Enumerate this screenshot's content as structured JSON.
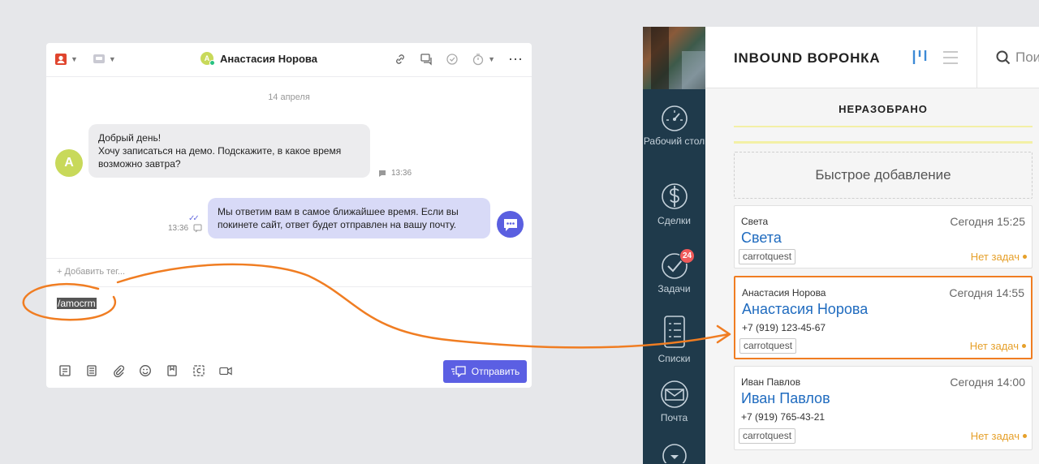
{
  "chat": {
    "contact_name": "Анастасия Норова",
    "avatar_letter": "А",
    "date_separator": "14 апреля",
    "incoming": {
      "lines": [
        "Добрый день!",
        "Хочу записаться на демо. Подскажите, в какое время",
        "возможно завтра?"
      ],
      "time": "13:36"
    },
    "outgoing": {
      "lines": [
        "Мы ответим вам в самое ближайшее время. Если вы",
        "покинете сайт, ответ будет отправлен на вашу почту."
      ],
      "time": "13:36"
    },
    "add_tag": "+ Добавить тег...",
    "compose_text": "/amocrm",
    "send_label": "Отправить"
  },
  "crm": {
    "pipeline_title": "INBOUND ВОРОНКА",
    "search_placeholder": "Пои",
    "column_title": "НЕРАЗОБРАНО",
    "quick_add": "Быстрое добавление",
    "sidebar": [
      {
        "label": "Рабочий стол"
      },
      {
        "label": "Сделки"
      },
      {
        "label": "Задачи",
        "badge": "24"
      },
      {
        "label": "Списки"
      },
      {
        "label": "Почта"
      }
    ],
    "cards": [
      {
        "contact": "Света",
        "time": "Сегодня 15:25",
        "name": "Света",
        "phone": "",
        "tag": "carrotquest",
        "tasks": "Нет задач"
      },
      {
        "contact": "Анастасия Норова",
        "time": "Сегодня 14:55",
        "name": "Анастасия Норова",
        "phone": "+7 (919) 123-45-67",
        "tag": "carrotquest",
        "tasks": "Нет задач"
      },
      {
        "contact": "Иван Павлов",
        "time": "Сегодня 14:00",
        "name": "Иван Павлов",
        "phone": "+7 (919) 765-43-21",
        "tag": "carrotquest",
        "tasks": "Нет задач"
      }
    ]
  },
  "colors": {
    "accent_purple": "#5b5fe3",
    "highlight_orange": "#f07d22",
    "link_blue": "#1f6bbf",
    "sidebar_dark": "#1f3a4b"
  }
}
